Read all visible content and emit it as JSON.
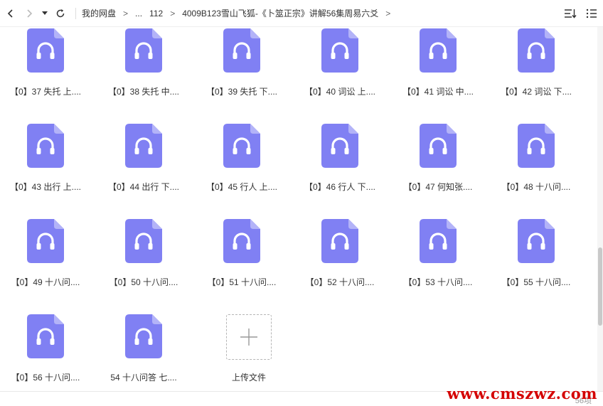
{
  "toolbar": {
    "back_icon": "chevron-left-icon",
    "forward_icon": "chevron-right-icon",
    "history_icon": "caret-down-icon",
    "refresh_icon": "refresh-icon",
    "breadcrumbs": [
      "我的网盘",
      "...",
      "112",
      "4009B123雪山飞狐-《卜筮正宗》讲解56集周易六爻"
    ],
    "separator": ">",
    "sort_icon": "sort-icon",
    "more_icon": "more-vertical-icon"
  },
  "files": [
    {
      "label": "【0】37 失托 上...."
    },
    {
      "label": "【0】38 失托 中...."
    },
    {
      "label": "【0】39 失托 下...."
    },
    {
      "label": "【0】40 词讼 上...."
    },
    {
      "label": "【0】41 词讼 中...."
    },
    {
      "label": "【0】42 词讼 下...."
    },
    {
      "label": "【0】43 出行 上...."
    },
    {
      "label": "【0】44 出行 下...."
    },
    {
      "label": "【0】45 行人 上...."
    },
    {
      "label": "【0】46 行人 下...."
    },
    {
      "label": "【0】47 何知张...."
    },
    {
      "label": "【0】48 十八问...."
    },
    {
      "label": "【0】49 十八问...."
    },
    {
      "label": "【0】50 十八问...."
    },
    {
      "label": "【0】51 十八问...."
    },
    {
      "label": "【0】52 十八问...."
    },
    {
      "label": "【0】53 十八问...."
    },
    {
      "label": "【0】55 十八问...."
    },
    {
      "label": "【0】56 十八问...."
    },
    {
      "label": "54 十八问答 七...."
    }
  ],
  "upload": {
    "label": "上传文件",
    "icon": "plus-icon"
  },
  "status": {
    "count": "56项"
  },
  "watermark": "www.cmszwz.com",
  "colors": {
    "file_icon": "#8080f3",
    "file_icon_fold": "#b3b3f8",
    "watermark": "#d40000"
  }
}
